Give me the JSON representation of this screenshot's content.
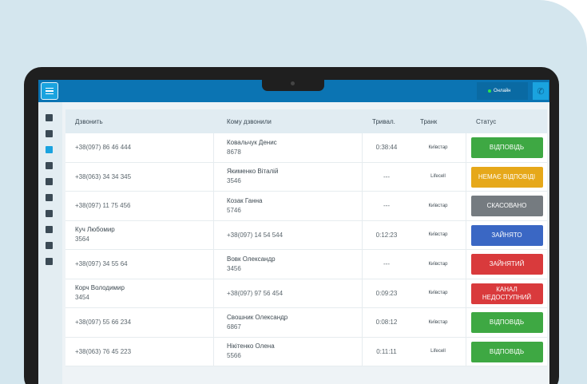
{
  "topbar": {
    "online_label": "Онлайн",
    "accent": "#0b74b3"
  },
  "sidebar": {
    "icons": [
      "chat-icon",
      "dashboard-icon",
      "calls-icon",
      "document-icon",
      "users-icon",
      "lock-icon",
      "contact-card-icon",
      "settings-icon",
      "monitor-icon",
      "extensions-icon"
    ],
    "active": "calls-icon"
  },
  "table": {
    "headers": {
      "caller": "Дзвонить",
      "callee": "Кому дзвонили",
      "duration": "Тривал.",
      "trunk": "Транк",
      "status": "Статус"
    },
    "rows": [
      {
        "caller_name": "",
        "caller_number": "+38(097) 86 46 444",
        "callee_name": "Ковальчук Денис",
        "callee_number": "8678",
        "duration": "0:38:44",
        "trunk": "Київстар",
        "status": "ВІДПОВІДЬ",
        "status_color": "#3ea843"
      },
      {
        "caller_name": "",
        "caller_number": "+38(063) 34 34 345",
        "callee_name": "Якименко Віталій",
        "callee_number": "3546",
        "duration": "---",
        "trunk": "Lifecell",
        "status": "НЕМАЄ ВІДПОВІДІ",
        "status_color": "#e6a81a"
      },
      {
        "caller_name": "",
        "caller_number": "+38(097) 11 75 456",
        "callee_name": "Козак Ганна",
        "callee_number": "5746",
        "duration": "---",
        "trunk": "Київстар",
        "status": "СКАСОВАНО",
        "status_color": "#757b80"
      },
      {
        "caller_name": "Куч Любомир",
        "caller_number": "3564",
        "callee_name": "",
        "callee_number": "+38(097) 14 54 544",
        "duration": "0:12:23",
        "trunk": "Київстар",
        "status": "ЗАЙНЯТО",
        "status_color": "#3a67c4"
      },
      {
        "caller_name": "",
        "caller_number": "+38(097) 34 55 64",
        "callee_name": "Вовк Олександр",
        "callee_number": "3456",
        "duration": "---",
        "trunk": "Київстар",
        "status": "ЗАЙНЯТИЙ",
        "status_color": "#d93a3c"
      },
      {
        "caller_name": "Корч Володимир",
        "caller_number": "3454",
        "callee_name": "",
        "callee_number": "+38(097) 97 56 454",
        "duration": "0:09:23",
        "trunk": "Київстар",
        "status": "КАНАЛ НЕДОСТУПНИЙ",
        "status_color": "#d93a3c"
      },
      {
        "caller_name": "",
        "caller_number": "+38(097) 55 66 234",
        "callee_name": "Свошник Олександр",
        "callee_number": "6867",
        "duration": "0:08:12",
        "trunk": "Київстар",
        "status": "ВІДПОВІДЬ",
        "status_color": "#3ea843"
      },
      {
        "caller_name": "",
        "caller_number": "+38(063) 76 45 223",
        "callee_name": "Нікітенко Олена",
        "callee_number": "5566",
        "duration": "0:11:11",
        "trunk": "Lifecell",
        "status": "ВІДПОВІДЬ",
        "status_color": "#3ea843"
      }
    ]
  }
}
